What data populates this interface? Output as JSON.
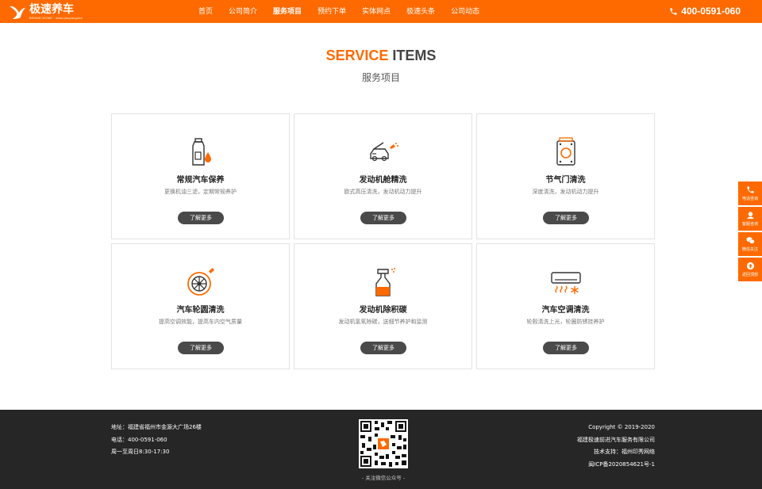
{
  "header": {
    "logo_name": "极速养车",
    "logo_sub": "BRAND HOME · www.jisuyangche",
    "nav": [
      "首页",
      "公司简介",
      "服务项目",
      "预约下单",
      "实体网点",
      "极速头条",
      "公司动态"
    ],
    "nav_active": 2,
    "phone": "400-0591-060"
  },
  "section": {
    "title_en_highlight": "SERVICE",
    "title_en_rest": " ITEMS",
    "title_cn": "服务项目"
  },
  "cards": [
    {
      "name": "常规汽车保养",
      "desc": "更换机油三滤，定期常规养护",
      "more": "了解更多",
      "icon": "oil-bottle-icon"
    },
    {
      "name": "发动机舱精洗",
      "desc": "欧式高压清洗，发动机动力提升",
      "more": "了解更多",
      "icon": "engine-bay-icon"
    },
    {
      "name": "节气门清洗",
      "desc": "深度清洗，发动机动力提升",
      "more": "了解更多",
      "icon": "throttle-icon"
    },
    {
      "name": "汽车轮圆清洗",
      "desc": "提高空调效能，提高车内空气质量",
      "more": "了解更多",
      "icon": "wheel-icon"
    },
    {
      "name": "发动机除积碳",
      "desc": "发动机氢氧除碳，送细节养护和监测",
      "more": "了解更多",
      "icon": "spray-bottle-icon"
    },
    {
      "name": "汽车空调清洗",
      "desc": "轮毂清洗上光，轮圈防锈挂养护",
      "more": "了解更多",
      "icon": "air-conditioner-icon"
    }
  ],
  "side": [
    "电话咨询",
    "客服咨询",
    "微信关注",
    "返回顶部"
  ],
  "footer": {
    "address": "地址：福建省福州市金源大广场26楼",
    "tel": "电话：400-0591-060",
    "hours": "周一至周日8:30-17:30",
    "qr_caption": "- 关注微信公众号 -",
    "copyright": "Copyright © 2019-2020",
    "company": "福建极速前进汽车服务有限公司",
    "support": "技术支持：福州印秀网络",
    "icp": "闽ICP备2020854621号-1"
  },
  "colors": {
    "accent": "#ff6a00",
    "dark": "#262626",
    "button": "#4a4a4a"
  }
}
